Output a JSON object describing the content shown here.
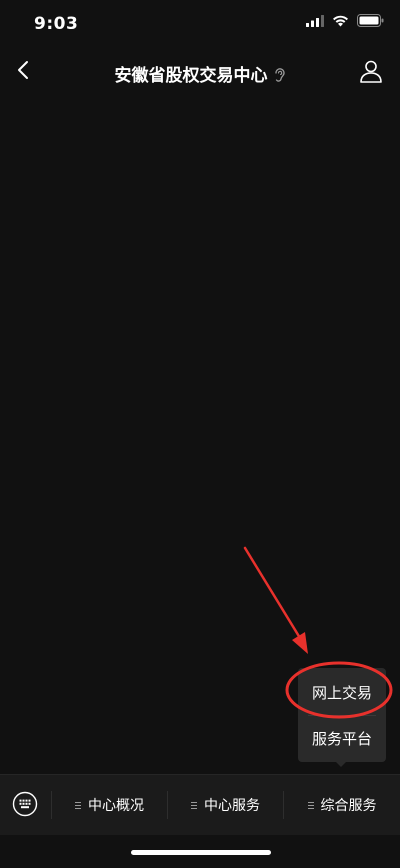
{
  "status_bar": {
    "time": "9:03",
    "icons": [
      "cellular-signal-icon",
      "wifi-icon",
      "battery-icon"
    ]
  },
  "nav": {
    "back_icon": "chevron-left-icon",
    "title": "安徽省股权交易中心",
    "title_badge_icon": "ear-icon",
    "profile_icon": "user-profile-icon"
  },
  "popup_menu": {
    "items": [
      {
        "label": "网上交易"
      },
      {
        "label": "服务平台"
      }
    ]
  },
  "tab_bar": {
    "keyboard_icon": "keyboard-icon",
    "menu_icon": "menu-lines-icon",
    "tabs": [
      {
        "label": "中心概况"
      },
      {
        "label": "中心服务"
      },
      {
        "label": "综合服务"
      }
    ]
  },
  "annotation": {
    "arrow_color": "#e8312c",
    "highlight_color": "#e8312c"
  },
  "colors": {
    "background": "#111111",
    "tab_bar": "#1b1b1b",
    "popup": "#2a2a2a",
    "text": "#ffffff"
  }
}
